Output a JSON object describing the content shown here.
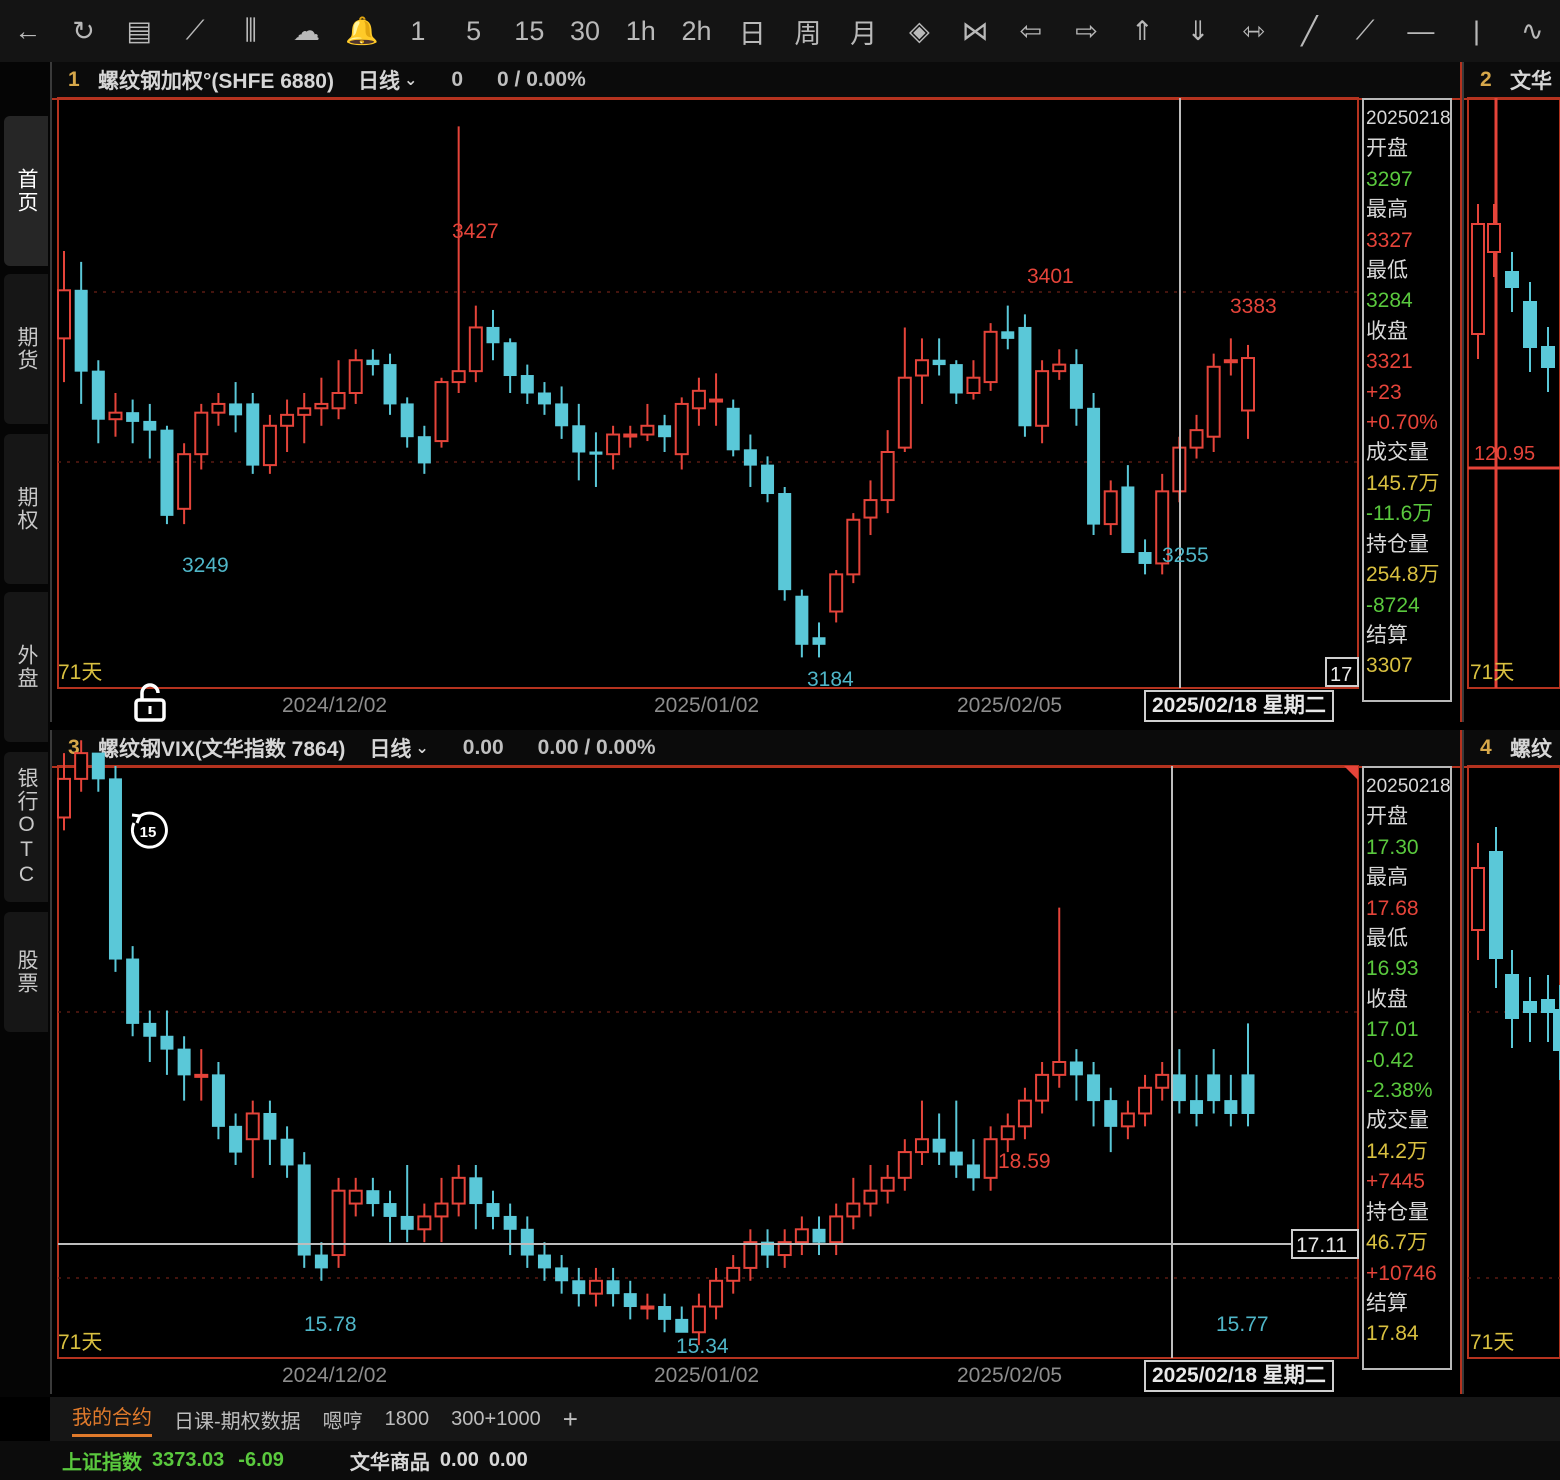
{
  "toolbar": {
    "buttons": [
      {
        "name": "back-button",
        "glyph": "←"
      },
      {
        "name": "refresh-button",
        "glyph": "↻"
      },
      {
        "name": "quote-list-button",
        "glyph": "▤"
      },
      {
        "name": "timeshare-chart-button",
        "glyph": "⟋"
      },
      {
        "name": "kline-button",
        "glyph": "⫼"
      },
      {
        "name": "cloud-button",
        "glyph": "☁"
      },
      {
        "name": "alert-button",
        "glyph": "🔔"
      },
      {
        "name": "period-1-button",
        "glyph": "1"
      },
      {
        "name": "period-5-button",
        "glyph": "5"
      },
      {
        "name": "period-15-button",
        "glyph": "15"
      },
      {
        "name": "period-30-button",
        "glyph": "30"
      },
      {
        "name": "period-1h-button",
        "glyph": "1h"
      },
      {
        "name": "period-2h-button",
        "glyph": "2h"
      },
      {
        "name": "period-day-button",
        "glyph": "日"
      },
      {
        "name": "period-week-button",
        "glyph": "周"
      },
      {
        "name": "period-month-button",
        "glyph": "月"
      },
      {
        "name": "zoom-in-button",
        "glyph": "◈"
      },
      {
        "name": "zoom-out-button",
        "glyph": "⋈"
      },
      {
        "name": "move-left-button",
        "glyph": "⇦"
      },
      {
        "name": "move-right-button",
        "glyph": "⇨"
      },
      {
        "name": "move-up-button",
        "glyph": "⇑"
      },
      {
        "name": "move-down-button",
        "glyph": "⇓"
      },
      {
        "name": "fit-button",
        "glyph": "⇿"
      },
      {
        "name": "line-tool-button",
        "glyph": "╱"
      },
      {
        "name": "ray-tool-button",
        "glyph": "⟋"
      },
      {
        "name": "hline-tool-button",
        "glyph": "—"
      },
      {
        "name": "vline-tool-button",
        "glyph": "|"
      },
      {
        "name": "wave-tool-button",
        "glyph": "∿"
      }
    ]
  },
  "sidebar": {
    "items": [
      "首页",
      "期货",
      "期权",
      "外盘",
      "银行OTC",
      "股票"
    ]
  },
  "panel1": {
    "num": "1",
    "name": "螺纹钢加权°(SHFE 6880)",
    "cycle": "日线",
    "v1": "0",
    "v2": "0 / 0.00%",
    "days": "71天",
    "count": "17",
    "dates": [
      "2024/12/02",
      "2025/01/02",
      "2025/02/05"
    ],
    "cursor_date": "2025/02/18 星期二",
    "info": [
      {
        "t": "20250218",
        "c": "date"
      },
      {
        "t": "开盘",
        "c": "lbl"
      },
      {
        "t": "3297",
        "c": "cd"
      },
      {
        "t": "最高",
        "c": "lbl"
      },
      {
        "t": "3327",
        "c": "cu"
      },
      {
        "t": "最低",
        "c": "lbl"
      },
      {
        "t": "3284",
        "c": "cd"
      },
      {
        "t": "收盘",
        "c": "lbl"
      },
      {
        "t": "3321",
        "c": "cu"
      },
      {
        "t": "+23",
        "c": "cu"
      },
      {
        "t": "+0.70%",
        "c": "cu"
      },
      {
        "t": "成交量",
        "c": "lbl"
      },
      {
        "t": "145.7万",
        "c": "cy"
      },
      {
        "t": "-11.6万",
        "c": "cd"
      },
      {
        "t": "持仓量",
        "c": "lbl"
      },
      {
        "t": "254.8万",
        "c": "cy"
      },
      {
        "t": "-8724",
        "c": "cd"
      },
      {
        "t": "结算",
        "c": "lbl"
      },
      {
        "t": "3307",
        "c": "cy"
      }
    ]
  },
  "panel2": {
    "num": "2",
    "name": "文华",
    "value": "120.95",
    "days": "71天"
  },
  "panel3": {
    "num": "3",
    "name": "螺纹钢VIX(文华指数 7864)",
    "cycle": "日线",
    "v1": "0.00",
    "v2": "0.00 / 0.00%",
    "days": "71天",
    "last": "17.11",
    "dates": [
      "2024/12/02",
      "2025/01/02",
      "2025/02/05"
    ],
    "cursor_date": "2025/02/18 星期二",
    "info": [
      {
        "t": "20250218",
        "c": "date"
      },
      {
        "t": "开盘",
        "c": "lbl"
      },
      {
        "t": "17.30",
        "c": "cd"
      },
      {
        "t": "最高",
        "c": "lbl"
      },
      {
        "t": "17.68",
        "c": "cu"
      },
      {
        "t": "最低",
        "c": "lbl"
      },
      {
        "t": "16.93",
        "c": "cd"
      },
      {
        "t": "收盘",
        "c": "lbl"
      },
      {
        "t": "17.01",
        "c": "cd"
      },
      {
        "t": "-0.42",
        "c": "cd"
      },
      {
        "t": "-2.38%",
        "c": "cd"
      },
      {
        "t": "成交量",
        "c": "lbl"
      },
      {
        "t": "14.2万",
        "c": "cy"
      },
      {
        "t": "+7445",
        "c": "cu"
      },
      {
        "t": "持仓量",
        "c": "lbl"
      },
      {
        "t": "46.7万",
        "c": "cy"
      },
      {
        "t": "+10746",
        "c": "cu"
      },
      {
        "t": "结算",
        "c": "lbl"
      },
      {
        "t": "17.84",
        "c": "cy"
      }
    ]
  },
  "panel4": {
    "num": "4",
    "name": "螺纹",
    "days": "71天"
  },
  "bottom_tabs": [
    "我的合约",
    "日课-期权数据",
    "嗯哼",
    "1800",
    "300+1000"
  ],
  "add_tab": "+",
  "status": {
    "index_name": "上证指数",
    "index_value": "3373.03",
    "index_change": "-6.09",
    "sector_name": "文华商品",
    "sector_value": "0.00",
    "sector_change": "0.00"
  },
  "colors": {
    "up": "#e5443a",
    "down": "#5ac8d8",
    "border": "#b5331f"
  },
  "chart_data": [
    {
      "type": "candlestick",
      "title": "螺纹钢加权°(SHFE 6880)",
      "ylim": [
        3170,
        3440
      ],
      "x_ticks": [
        "2024/12/02",
        "2025/01/02",
        "2025/02/05"
      ],
      "candles": [
        [
          3330,
          3352,
          3370,
          3310
        ],
        [
          3352,
          3315,
          3365,
          3300
        ],
        [
          3315,
          3293,
          3320,
          3282
        ],
        [
          3293,
          3296,
          3305,
          3285
        ],
        [
          3296,
          3292,
          3302,
          3282
        ],
        [
          3292,
          3288,
          3300,
          3275
        ],
        [
          3288,
          3249,
          3290,
          3245
        ],
        [
          3252,
          3277,
          3282,
          3245
        ],
        [
          3277,
          3296,
          3300,
          3270
        ],
        [
          3296,
          3300,
          3305,
          3290
        ],
        [
          3300,
          3295,
          3310,
          3287
        ],
        [
          3300,
          3272,
          3305,
          3268
        ],
        [
          3272,
          3290,
          3295,
          3268
        ],
        [
          3290,
          3295,
          3302,
          3278
        ],
        [
          3295,
          3298,
          3305,
          3282
        ],
        [
          3298,
          3300,
          3312,
          3290
        ],
        [
          3298,
          3305,
          3320,
          3293
        ],
        [
          3305,
          3320,
          3325,
          3300
        ],
        [
          3320,
          3318,
          3325,
          3313
        ],
        [
          3318,
          3300,
          3323,
          3295
        ],
        [
          3300,
          3285,
          3303,
          3280
        ],
        [
          3285,
          3273,
          3290,
          3268
        ],
        [
          3283,
          3310,
          3312,
          3280
        ],
        [
          3310,
          3315,
          3427,
          3305
        ],
        [
          3315,
          3335,
          3345,
          3310
        ],
        [
          3335,
          3328,
          3343,
          3320
        ],
        [
          3328,
          3313,
          3330,
          3305
        ],
        [
          3313,
          3305,
          3318,
          3300
        ],
        [
          3305,
          3300,
          3310,
          3295
        ],
        [
          3300,
          3290,
          3308,
          3284
        ],
        [
          3290,
          3278,
          3300,
          3265
        ],
        [
          3278,
          3277,
          3287,
          3262
        ],
        [
          3277,
          3286,
          3290,
          3270
        ],
        [
          3286,
          3286,
          3290,
          3280
        ],
        [
          3286,
          3290,
          3300,
          3283
        ],
        [
          3290,
          3285,
          3295,
          3278
        ],
        [
          3277,
          3300,
          3303,
          3270
        ],
        [
          3298,
          3306,
          3312,
          3290
        ],
        [
          3302,
          3302,
          3314,
          3290
        ],
        [
          3298,
          3279,
          3302,
          3276
        ],
        [
          3279,
          3272,
          3286,
          3262
        ],
        [
          3272,
          3259,
          3276,
          3255
        ],
        [
          3259,
          3215,
          3262,
          3210
        ],
        [
          3212,
          3190,
          3215,
          3184
        ],
        [
          3193,
          3190,
          3200,
          3184
        ],
        [
          3205,
          3222,
          3224,
          3200
        ],
        [
          3222,
          3247,
          3250,
          3218
        ],
        [
          3248,
          3256,
          3265,
          3240
        ],
        [
          3256,
          3278,
          3288,
          3250
        ],
        [
          3280,
          3312,
          3335,
          3278
        ],
        [
          3313,
          3320,
          3330,
          3300
        ],
        [
          3320,
          3318,
          3330,
          3313
        ],
        [
          3318,
          3305,
          3320,
          3300
        ],
        [
          3305,
          3312,
          3320,
          3302
        ],
        [
          3310,
          3333,
          3337,
          3306
        ],
        [
          3333,
          3330,
          3345,
          3325
        ],
        [
          3335,
          3290,
          3341,
          3285
        ],
        [
          3290,
          3315,
          3320,
          3282
        ],
        [
          3315,
          3318,
          3325,
          3311
        ],
        [
          3318,
          3298,
          3325,
          3290
        ],
        [
          3298,
          3245,
          3305,
          3240
        ],
        [
          3245,
          3260,
          3265,
          3240
        ],
        [
          3262,
          3232,
          3272,
          3232
        ],
        [
          3232,
          3227,
          3238,
          3222
        ],
        [
          3227,
          3260,
          3268,
          3222
        ],
        [
          3260,
          3280,
          3285,
          3255
        ],
        [
          3280,
          3288,
          3295,
          3275
        ],
        [
          3285,
          3317,
          3323,
          3278
        ],
        [
          3320,
          3320,
          3330,
          3313
        ],
        [
          3297,
          3321,
          3327,
          3284
        ]
      ],
      "labels": [
        {
          "t": "3249"
        },
        {
          "t": "3427"
        },
        {
          "t": "3184"
        },
        {
          "t": "3401"
        },
        {
          "t": "3255"
        },
        {
          "t": "3383"
        }
      ]
    },
    {
      "type": "candlestick",
      "title": "螺纹钢VIX(文华指数 7864)",
      "ylim": [
        15.1,
        19.7
      ],
      "x_ticks": [
        "2024/12/02",
        "2025/01/02",
        "2025/02/05"
      ],
      "candles": [
        [
          19.3,
          19.6,
          19.8,
          19.2
        ],
        [
          19.6,
          19.8,
          19.9,
          19.5
        ],
        [
          19.8,
          19.6,
          19.8,
          19.5
        ],
        [
          19.6,
          18.2,
          19.7,
          18.1
        ],
        [
          18.2,
          17.7,
          18.3,
          17.6
        ],
        [
          17.7,
          17.6,
          17.8,
          17.4
        ],
        [
          17.6,
          17.5,
          17.8,
          17.3
        ],
        [
          17.5,
          17.3,
          17.6,
          17.1
        ],
        [
          17.3,
          17.3,
          17.5,
          17.1
        ],
        [
          17.3,
          16.9,
          17.4,
          16.8
        ],
        [
          16.9,
          16.7,
          17.0,
          16.6
        ],
        [
          16.8,
          17.0,
          17.1,
          16.5
        ],
        [
          17.0,
          16.8,
          17.1,
          16.6
        ],
        [
          16.8,
          16.6,
          16.9,
          16.5
        ],
        [
          16.6,
          15.9,
          16.7,
          15.8
        ],
        [
          15.9,
          15.8,
          16.0,
          15.7
        ],
        [
          15.9,
          16.4,
          16.5,
          15.8
        ],
        [
          16.3,
          16.4,
          16.5,
          16.2
        ],
        [
          16.4,
          16.3,
          16.5,
          16.2
        ],
        [
          16.3,
          16.2,
          16.4,
          16.0
        ],
        [
          16.2,
          16.1,
          16.6,
          16.0
        ],
        [
          16.1,
          16.2,
          16.3,
          16.0
        ],
        [
          16.2,
          16.3,
          16.5,
          16.0
        ],
        [
          16.3,
          16.5,
          16.6,
          16.2
        ],
        [
          16.5,
          16.3,
          16.6,
          16.1
        ],
        [
          16.3,
          16.2,
          16.4,
          16.1
        ],
        [
          16.2,
          16.1,
          16.3,
          15.9
        ],
        [
          16.1,
          15.9,
          16.2,
          15.8
        ],
        [
          15.9,
          15.8,
          16.0,
          15.7
        ],
        [
          15.8,
          15.7,
          15.9,
          15.6
        ],
        [
          15.7,
          15.6,
          15.8,
          15.5
        ],
        [
          15.6,
          15.7,
          15.8,
          15.5
        ],
        [
          15.7,
          15.6,
          15.8,
          15.5
        ],
        [
          15.6,
          15.5,
          15.7,
          15.4
        ],
        [
          15.5,
          15.5,
          15.6,
          15.4
        ],
        [
          15.5,
          15.4,
          15.6,
          15.3
        ],
        [
          15.4,
          15.3,
          15.5,
          15.3
        ],
        [
          15.3,
          15.5,
          15.6,
          15.2
        ],
        [
          15.5,
          15.7,
          15.8,
          15.4
        ],
        [
          15.7,
          15.8,
          15.9,
          15.6
        ],
        [
          15.8,
          16.0,
          16.1,
          15.7
        ],
        [
          16.0,
          15.9,
          16.1,
          15.8
        ],
        [
          15.9,
          16.0,
          16.1,
          15.8
        ],
        [
          16.0,
          16.1,
          16.2,
          15.9
        ],
        [
          16.1,
          16.0,
          16.2,
          15.9
        ],
        [
          16.0,
          16.2,
          16.3,
          15.9
        ],
        [
          16.2,
          16.3,
          16.5,
          16.1
        ],
        [
          16.3,
          16.4,
          16.6,
          16.2
        ],
        [
          16.4,
          16.5,
          16.6,
          16.3
        ],
        [
          16.5,
          16.7,
          16.8,
          16.4
        ],
        [
          16.7,
          16.8,
          17.1,
          16.6
        ],
        [
          16.8,
          16.7,
          17.0,
          16.6
        ],
        [
          16.7,
          16.6,
          17.1,
          16.5
        ],
        [
          16.6,
          16.5,
          16.8,
          16.4
        ],
        [
          16.5,
          16.8,
          16.9,
          16.4
        ],
        [
          16.8,
          16.9,
          17.0,
          16.7
        ],
        [
          16.9,
          17.1,
          17.2,
          16.8
        ],
        [
          17.1,
          17.3,
          17.4,
          17.0
        ],
        [
          17.3,
          17.4,
          18.6,
          17.2
        ],
        [
          17.4,
          17.3,
          17.5,
          17.1
        ],
        [
          17.3,
          17.1,
          17.4,
          16.9
        ],
        [
          17.1,
          16.9,
          17.2,
          16.7
        ],
        [
          16.9,
          17.0,
          17.1,
          16.8
        ],
        [
          17.0,
          17.2,
          17.3,
          16.9
        ],
        [
          17.2,
          17.3,
          17.4,
          17.1
        ],
        [
          17.3,
          17.1,
          17.5,
          17.0
        ],
        [
          17.1,
          17.0,
          17.3,
          16.9
        ],
        [
          17.3,
          17.1,
          17.5,
          17.0
        ],
        [
          17.1,
          17.0,
          17.3,
          16.9
        ],
        [
          17.3,
          17.0,
          17.7,
          16.9
        ]
      ],
      "labels": [
        {
          "t": "15.78"
        },
        {
          "t": "15.34"
        },
        {
          "t": "18.59"
        },
        {
          "t": "15.77"
        }
      ]
    }
  ]
}
